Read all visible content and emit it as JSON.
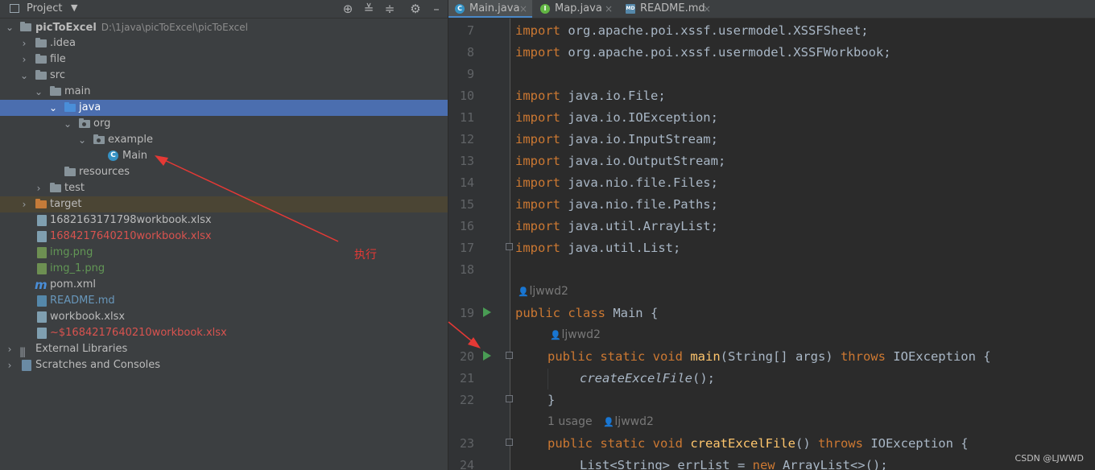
{
  "project_panel": {
    "title": "Project",
    "caret": "▼",
    "toolbar_icons": [
      "crosshair-icon",
      "expand-all-icon",
      "collapse-all-icon",
      "gear-icon",
      "minimize-icon"
    ]
  },
  "tree": [
    {
      "label": "picToExcel",
      "path": "D:\\1java\\picToExcel\\picToExcel"
    },
    {
      "label": ".idea"
    },
    {
      "label": "file"
    },
    {
      "label": "src"
    },
    {
      "label": "main"
    },
    {
      "label": "java"
    },
    {
      "label": "org"
    },
    {
      "label": "example"
    },
    {
      "label": "Main"
    },
    {
      "label": "resources"
    },
    {
      "label": "test"
    },
    {
      "label": "target"
    },
    {
      "label": "1682163171798workbook.xlsx"
    },
    {
      "label": "1684217640210workbook.xlsx"
    },
    {
      "label": "img.png"
    },
    {
      "label": "img_1.png"
    },
    {
      "label": "pom.xml"
    },
    {
      "label": "README.md"
    },
    {
      "label": "workbook.xlsx"
    },
    {
      "label": "~$1684217640210workbook.xlsx"
    },
    {
      "label": "External Libraries"
    },
    {
      "label": "Scratches and Consoles"
    }
  ],
  "annotation": "执行",
  "tabs": [
    {
      "label": "Main.java",
      "active": true,
      "icon": "C"
    },
    {
      "label": "Map.java",
      "active": false,
      "icon": "I"
    },
    {
      "label": "README.md",
      "active": false,
      "icon": "MD"
    }
  ],
  "editor": {
    "line_numbers": [
      "7",
      "8",
      "9",
      "10",
      "11",
      "12",
      "13",
      "14",
      "15",
      "16",
      "17",
      "18",
      "19",
      "20",
      "21",
      "22",
      "23",
      "24"
    ],
    "lines": {
      "l7_kw": "import",
      "l7": " org.apache.poi.xssf.usermodel.XSSFSheet;",
      "l8_kw": "import",
      "l8": " org.apache.poi.xssf.usermodel.XSSFWorkbook;",
      "l10_kw": "import",
      "l10": " java.io.File;",
      "l11_kw": "import",
      "l11": " java.io.IOException;",
      "l12_kw": "import",
      "l12": " java.io.InputStream;",
      "l13_kw": "import",
      "l13": " java.io.OutputStream;",
      "l14_kw": "import",
      "l14": " java.nio.file.Files;",
      "l15_kw": "import",
      "l15": " java.nio.file.Paths;",
      "l16_kw": "import",
      "l16": " java.util.ArrayList;",
      "l17_kw": "import",
      "l17": " java.util.List;",
      "hint1": "ljwwd2",
      "l19_kw": "public class",
      "l19": " Main {",
      "hint2": "ljwwd2",
      "l20_kw": "public static void",
      "l20_fn": "main",
      "l20_a": "(String[] args) ",
      "l20_kw2": "throws",
      "l20_b": " IOException {",
      "l21": "createExcelFile",
      "l21_b": "();",
      "l22": "}",
      "hint3_usage": "1 usage",
      "hint3": "ljwwd2",
      "l23_kw": "public static void",
      "l23_fn": "creatExcelFile",
      "l23_a": "() ",
      "l23_kw2": "throws",
      "l23_b": " IOException {",
      "l24_a": "List<String> errList = ",
      "l24_kw": "new",
      "l24_b": " ArrayList<>();"
    }
  },
  "watermark": "CSDN @LJWWD"
}
